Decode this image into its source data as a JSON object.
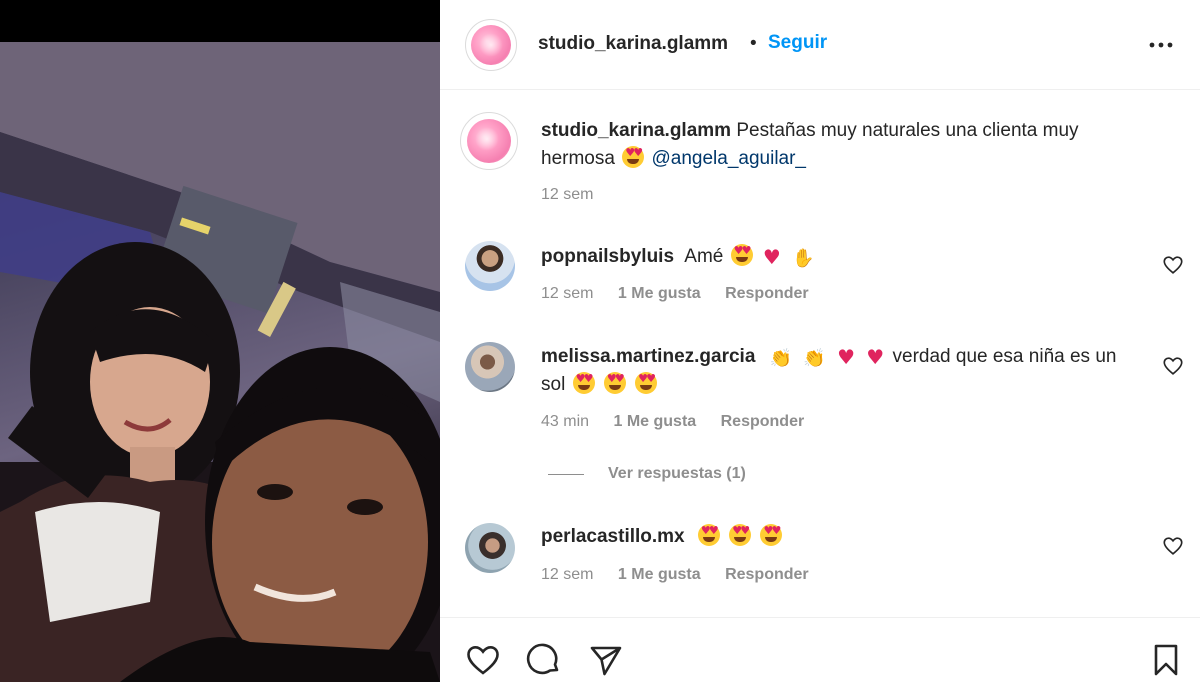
{
  "post": {
    "account": "studio_karina.glamm",
    "dot": "•",
    "follow_label": "Seguir",
    "more_icon": "more-horizontal-icon"
  },
  "caption": {
    "username": "studio_karina.glamm",
    "text": "Pestañas muy naturales una clienta muy hermosa",
    "mention": "@angela_aguilar_",
    "time": "12 sem"
  },
  "comments": [
    {
      "username": "popnailsbyluis",
      "text": "Amé",
      "time": "12 sem",
      "likes": "1 Me gusta",
      "reply": "Responder"
    },
    {
      "username": "melissa.martinez.garcia",
      "text_after": "verdad que esa niña es un sol",
      "time": "43 min",
      "likes": "1 Me gusta",
      "reply": "Responder",
      "view_replies": "Ver respuestas (1)"
    },
    {
      "username": "perlacastillo.mx",
      "time": "12 sem",
      "likes": "1 Me gusta",
      "reply": "Responder"
    }
  ],
  "colors": {
    "accent": "#0095f6",
    "mention": "#00376b",
    "muted": "#8e8e8e",
    "text": "#262626"
  }
}
